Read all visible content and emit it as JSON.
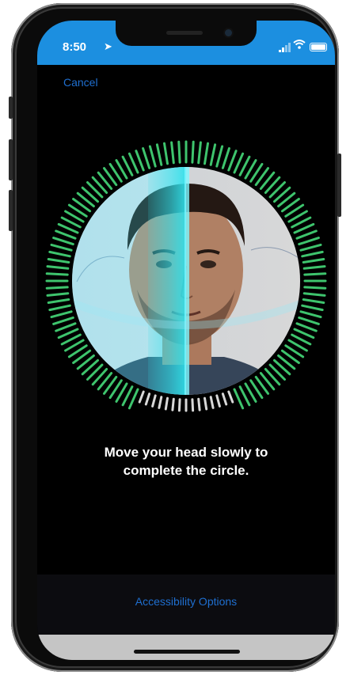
{
  "status_bar": {
    "time": "8:50",
    "background_color": "#1c8fe0",
    "icons": [
      "location-arrow-icon",
      "cellular-signal-icon",
      "wifi-icon",
      "battery-icon"
    ]
  },
  "nav": {
    "cancel_label": "Cancel"
  },
  "scan": {
    "progress_color": "#3ec46d",
    "pending_color": "#d8d8d8",
    "progress": 0.88
  },
  "instruction": {
    "line1": "Move your head slowly to",
    "line2": "complete the circle."
  },
  "footer": {
    "accessibility_label": "Accessibility Options"
  },
  "colors": {
    "link": "#1f6fd0",
    "accent_scan": "#2fe0ea"
  }
}
